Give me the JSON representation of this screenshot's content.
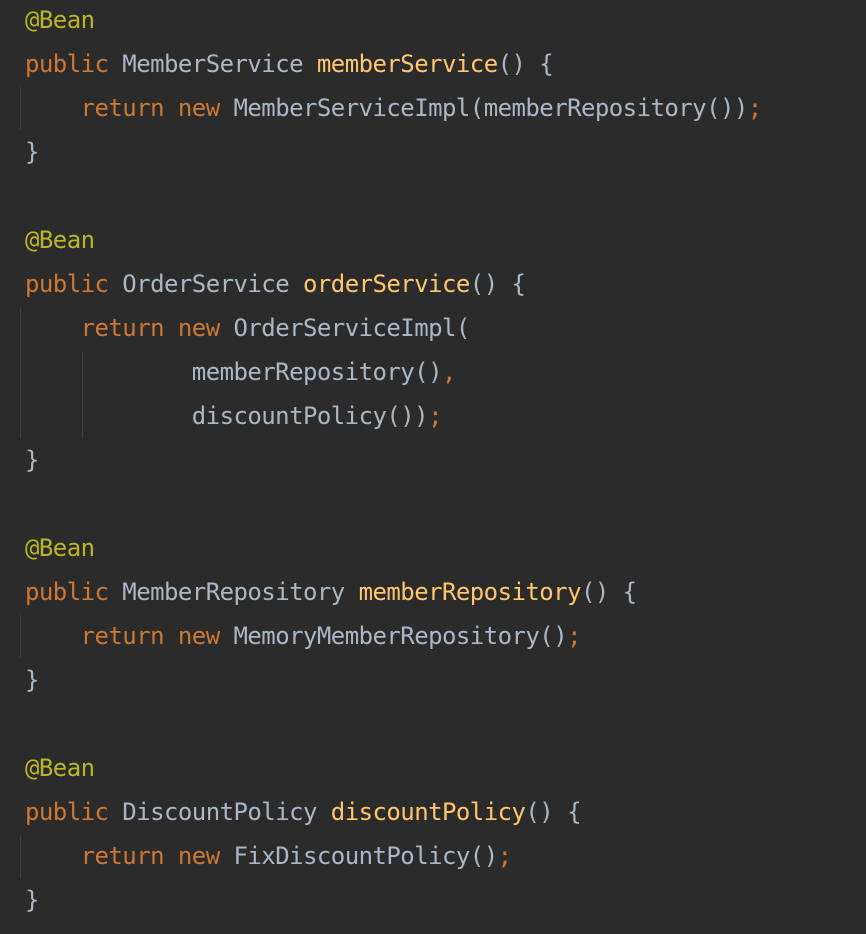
{
  "colors": {
    "background": "#2B2B2B",
    "annotation": "#BBB529",
    "keyword": "#CC7832",
    "method_declaration": "#FFC66D",
    "plain": "#A9B7C6",
    "indent_guide": "#3C3F41"
  },
  "code_lines": [
    {
      "segments": [
        {
          "text": "@Bean",
          "kind": "annotation"
        }
      ]
    },
    {
      "segments": [
        {
          "text": "public",
          "kind": "keyword"
        },
        {
          "text": " MemberService ",
          "kind": "plain"
        },
        {
          "text": "memberService",
          "kind": "method_declaration"
        },
        {
          "text": "() {",
          "kind": "plain"
        }
      ]
    },
    {
      "segments": [
        {
          "text": "    ",
          "kind": "plain"
        },
        {
          "text": "return new",
          "kind": "keyword"
        },
        {
          "text": " MemberServiceImpl(memberRepository())",
          "kind": "plain"
        },
        {
          "text": ";",
          "kind": "keyword"
        }
      ]
    },
    {
      "segments": [
        {
          "text": "}",
          "kind": "plain"
        }
      ]
    },
    {
      "segments": []
    },
    {
      "segments": [
        {
          "text": "@Bean",
          "kind": "annotation"
        }
      ]
    },
    {
      "segments": [
        {
          "text": "public",
          "kind": "keyword"
        },
        {
          "text": " OrderService ",
          "kind": "plain"
        },
        {
          "text": "orderService",
          "kind": "method_declaration"
        },
        {
          "text": "() {",
          "kind": "plain"
        }
      ]
    },
    {
      "segments": [
        {
          "text": "    ",
          "kind": "plain"
        },
        {
          "text": "return new",
          "kind": "keyword"
        },
        {
          "text": " OrderServiceImpl(",
          "kind": "plain"
        }
      ]
    },
    {
      "segments": [
        {
          "text": "            memberRepository()",
          "kind": "plain"
        },
        {
          "text": ",",
          "kind": "keyword"
        }
      ]
    },
    {
      "segments": [
        {
          "text": "            discountPolicy())",
          "kind": "plain"
        },
        {
          "text": ";",
          "kind": "keyword"
        }
      ]
    },
    {
      "segments": [
        {
          "text": "}",
          "kind": "plain"
        }
      ]
    },
    {
      "segments": []
    },
    {
      "segments": [
        {
          "text": "@Bean",
          "kind": "annotation"
        }
      ]
    },
    {
      "segments": [
        {
          "text": "public",
          "kind": "keyword"
        },
        {
          "text": " MemberRepository ",
          "kind": "plain"
        },
        {
          "text": "memberRepository",
          "kind": "method_declaration"
        },
        {
          "text": "() {",
          "kind": "plain"
        }
      ]
    },
    {
      "segments": [
        {
          "text": "    ",
          "kind": "plain"
        },
        {
          "text": "return new",
          "kind": "keyword"
        },
        {
          "text": " MemoryMemberRepository()",
          "kind": "plain"
        },
        {
          "text": ";",
          "kind": "keyword"
        }
      ]
    },
    {
      "segments": [
        {
          "text": "}",
          "kind": "plain"
        }
      ]
    },
    {
      "segments": []
    },
    {
      "segments": [
        {
          "text": "@Bean",
          "kind": "annotation"
        }
      ]
    },
    {
      "segments": [
        {
          "text": "public",
          "kind": "keyword"
        },
        {
          "text": " DiscountPolicy ",
          "kind": "plain"
        },
        {
          "text": "discountPolicy",
          "kind": "method_declaration"
        },
        {
          "text": "() {",
          "kind": "plain"
        }
      ]
    },
    {
      "segments": [
        {
          "text": "    ",
          "kind": "plain"
        },
        {
          "text": "return new",
          "kind": "keyword"
        },
        {
          "text": " FixDiscountPolicy()",
          "kind": "plain"
        },
        {
          "text": ";",
          "kind": "keyword"
        }
      ]
    },
    {
      "segments": [
        {
          "text": "}",
          "kind": "plain"
        }
      ]
    }
  ]
}
